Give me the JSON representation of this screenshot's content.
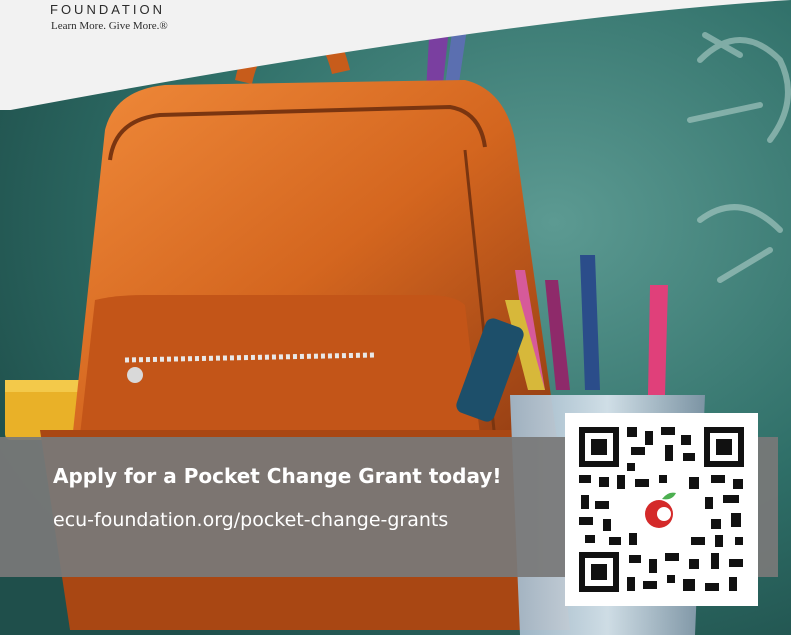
{
  "header": {
    "org_name": "FOUNDATION",
    "tagline": "Learn More. Give More.®"
  },
  "banner": {
    "headline": "Apply for a Pocket Change Grant today!",
    "url": "ecu-foundation.org/pocket-change-grants"
  },
  "colors": {
    "chalkboard": "#2f6f68",
    "backpack": "#d4661f",
    "banner": "#787878",
    "text": "#ffffff"
  },
  "icons": [
    "qr-code-icon",
    "apple-logo-icon"
  ]
}
